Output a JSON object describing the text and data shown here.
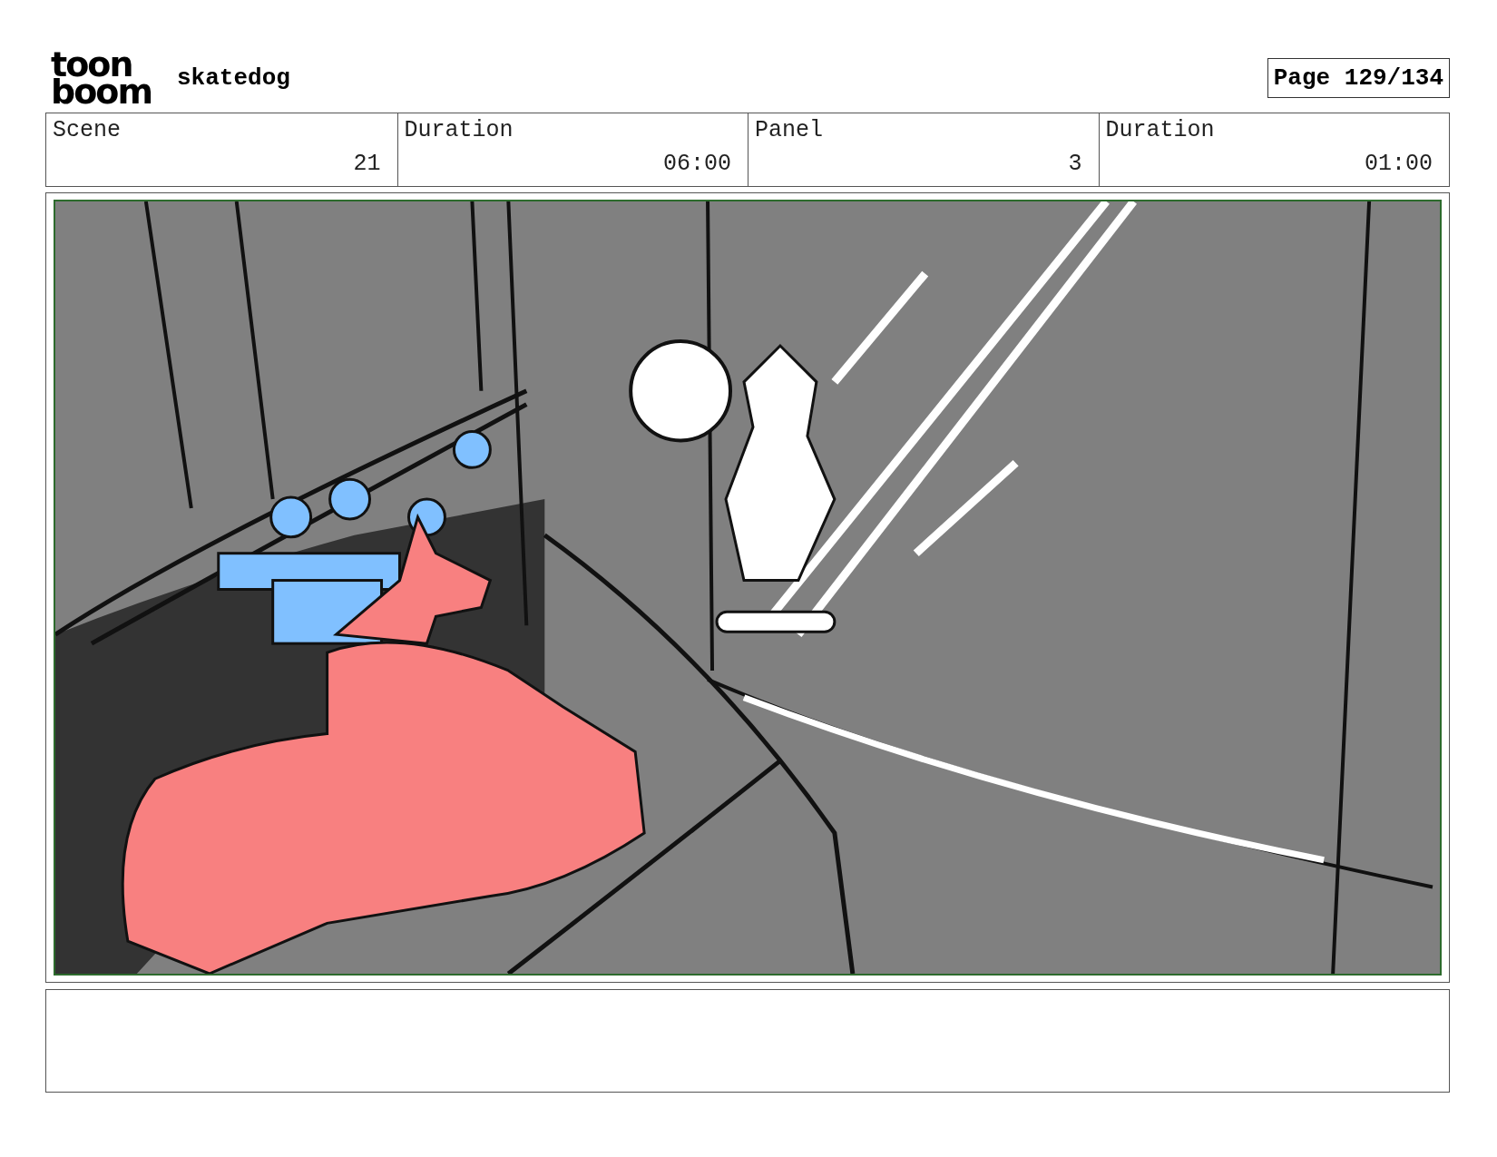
{
  "logo": {
    "top": "toon",
    "bottom": "boom"
  },
  "project_title": "skatedog",
  "page_label": "Page 129/134",
  "info_fields": [
    {
      "label": "Scene",
      "value": "21"
    },
    {
      "label": "Duration",
      "value": "06:00"
    },
    {
      "label": "Panel",
      "value": "3"
    },
    {
      "label": "Duration",
      "value": "01:00"
    }
  ]
}
